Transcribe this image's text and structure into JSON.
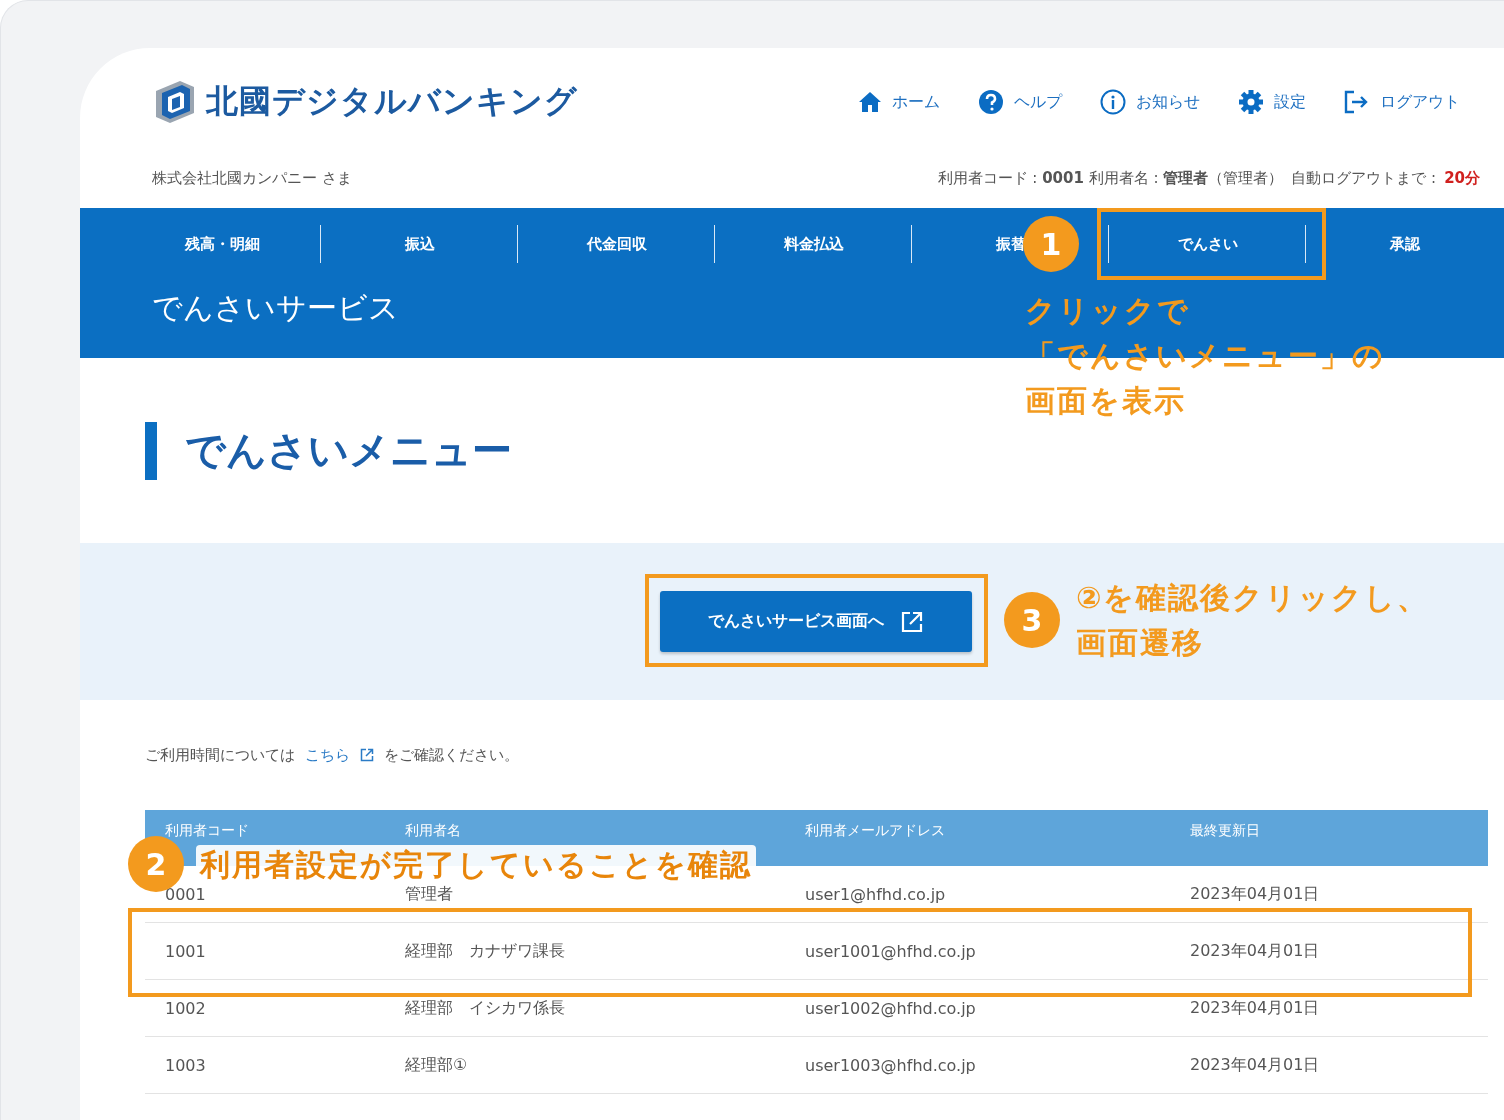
{
  "header": {
    "logo_text": "北國デジタルバンキング",
    "nav": [
      {
        "label": "ホーム"
      },
      {
        "label": "ヘルプ"
      },
      {
        "label": "お知らせ"
      },
      {
        "label": "設定"
      },
      {
        "label": "ログアウト"
      }
    ],
    "company": "株式会社北國カンパニー さま",
    "user_info": "利用者コード : **0001**  利用者名 : **管理者**（管理者）",
    "logout_label": "自動ログアウトまで :",
    "logout_time": "20分"
  },
  "tabs": [
    "残高・明細",
    "振込",
    "代金回収",
    "料金払込",
    "振替",
    "でんさい",
    "承認"
  ],
  "service_title": "でんさいサービス",
  "page_heading": "でんさいメニュー",
  "service_button": "でんさいサービス画面へ",
  "notice": {
    "before": "ご利用時間については",
    "link": "こちら",
    "after": "をご確認ください。"
  },
  "table": {
    "columns": [
      "利用者コード",
      "利用者名",
      "利用者メールアドレス",
      "最終更新日"
    ],
    "rows": [
      [
        "0001",
        "管理者",
        "user1@hfhd.co.jp",
        "2023年04月01日"
      ],
      [
        "1001",
        "経理部　カナザワ課長",
        "user1001@hfhd.co.jp",
        "2023年04月01日"
      ],
      [
        "1002",
        "経理部　イシカワ係長",
        "user1002@hfhd.co.jp",
        "2023年04月01日"
      ],
      [
        "1003",
        "経理部①",
        "user1003@hfhd.co.jp",
        "2023年04月01日"
      ]
    ]
  },
  "annotations": [
    {
      "number": "1",
      "lines": [
        "クリックで",
        "「でんさいメニュー」の",
        "画面を表示"
      ]
    },
    {
      "number": "2",
      "lines": [
        "利用者設定が完了していることを確認"
      ]
    },
    {
      "number": "3",
      "lines": [
        "②を確認後クリックし、",
        "画面遷移"
      ]
    }
  ]
}
